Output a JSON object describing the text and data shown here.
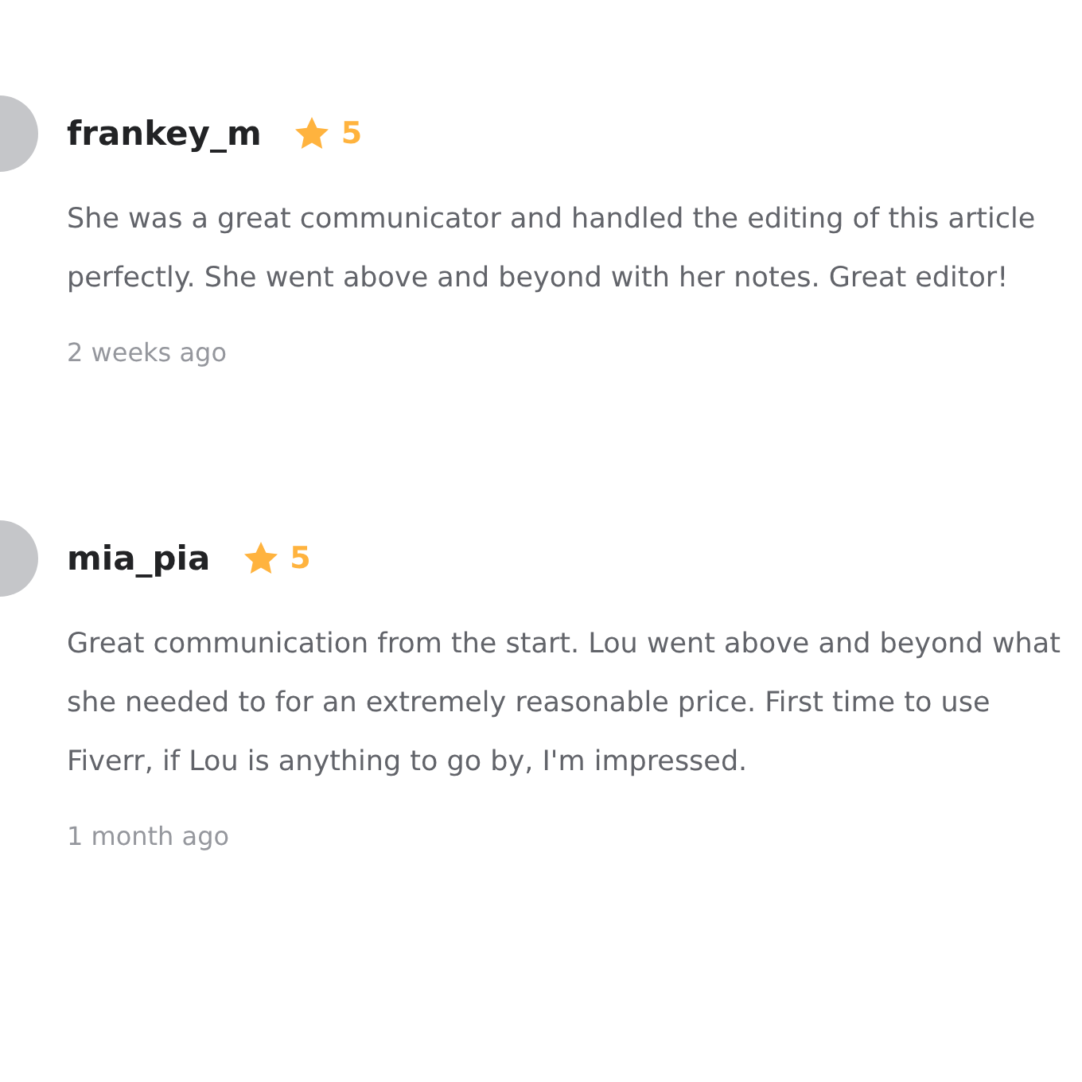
{
  "reviews": [
    {
      "username": "frankey_m",
      "rating": "5",
      "text": "She was a great communicator and handled the editing of this article perfectly. She went above and beyond with her notes. Great editor!",
      "time": "2 weeks ago"
    },
    {
      "username": "mia_pia",
      "rating": "5",
      "text": "Great communication from the start. Lou went above and beyond what she needed to for an extremely reasonable price. First time to use Fiverr, if Lou is anything to go by, I'm impressed.",
      "time": "1 month ago"
    }
  ]
}
